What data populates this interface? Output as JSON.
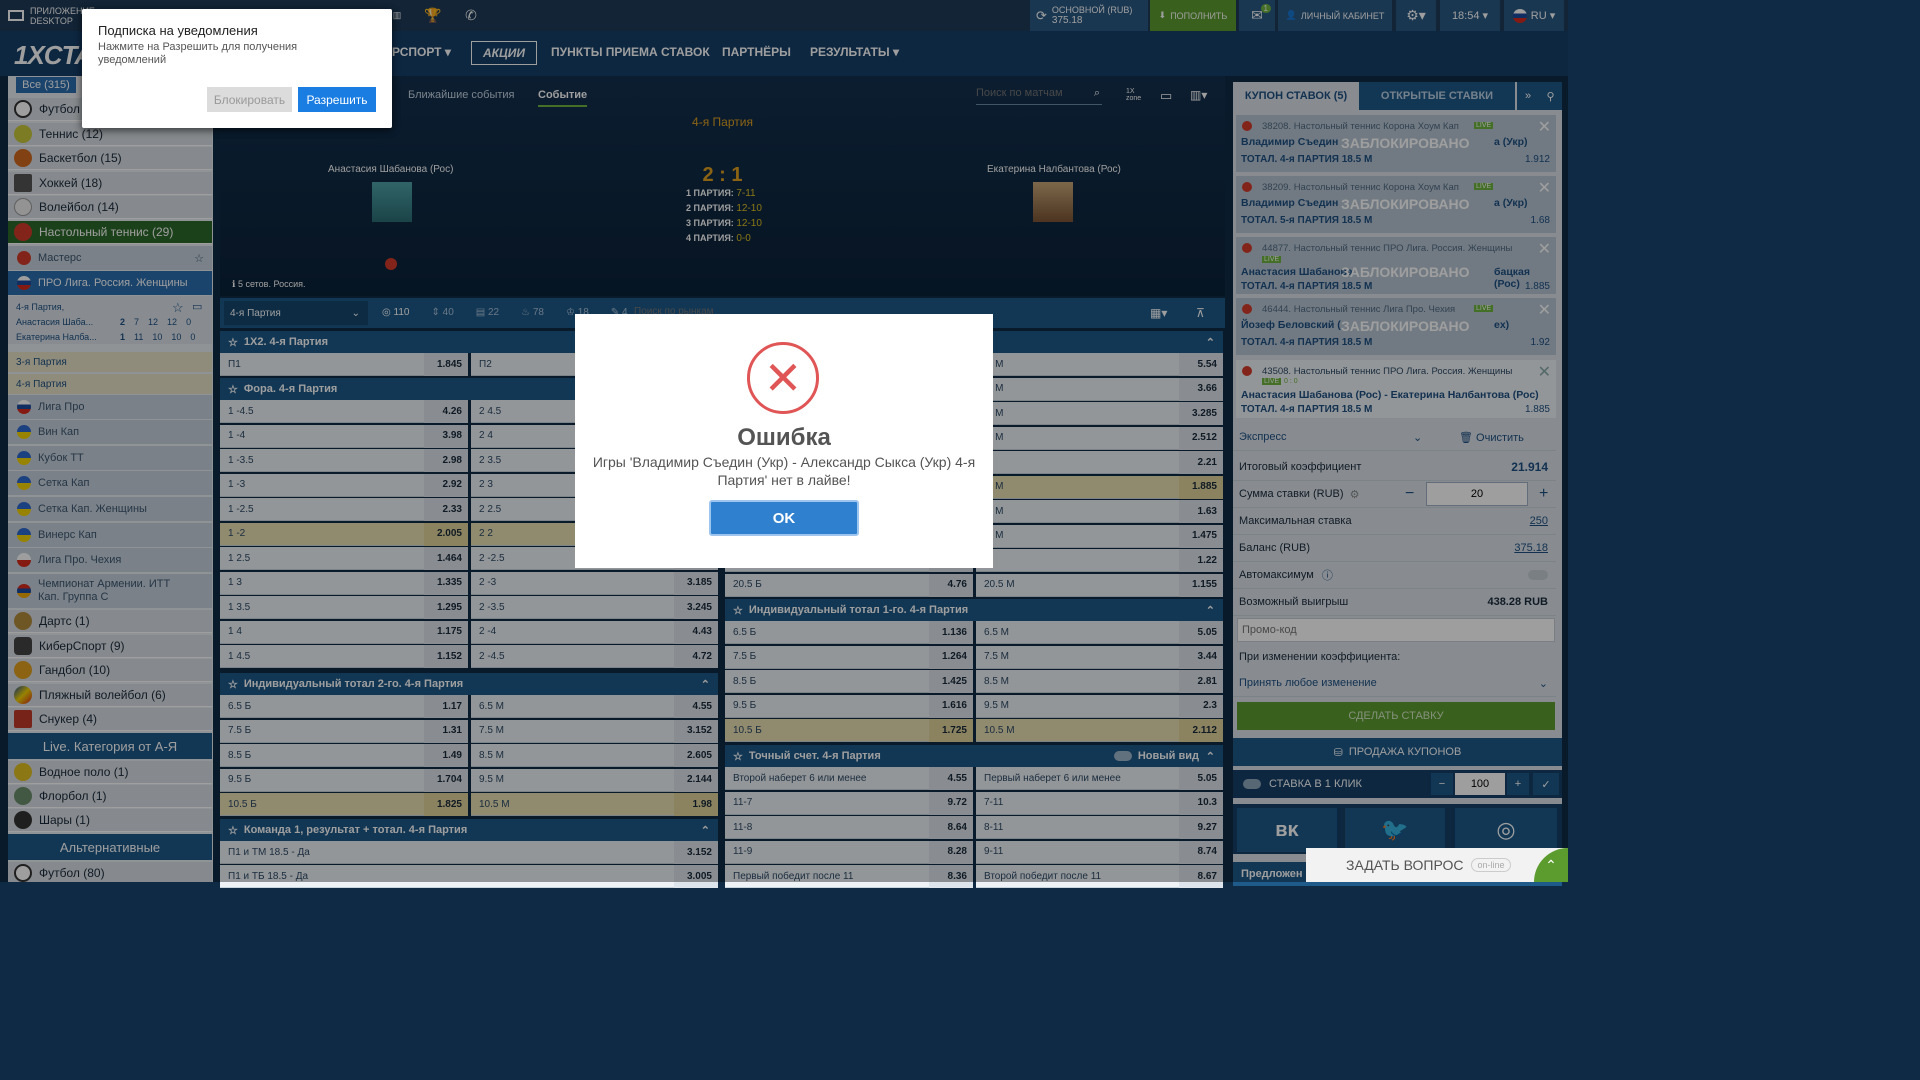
{
  "topbar": {
    "desktop_app": "ПРИЛОЖЕНИЕ DESKTOP",
    "balance_label": "ОСНОВНОЙ (RUB)",
    "balance_value": "375.18",
    "deposit": "ПОПОЛНИТЬ",
    "messages_count": "1",
    "cabinet": "ЛИЧНЫЙ КАБИНЕТ",
    "time": "18:54",
    "lang": "RU"
  },
  "nav": {
    "logo": "1XCTA",
    "items": [
      "РСПОРТ",
      "АКЦИИ",
      "ПУНКТЫ ПРИЕМА СТАВОК",
      "ПАРТНЁРЫ",
      "РЕЗУЛЬТАТЫ"
    ]
  },
  "notification": {
    "title": "Подписка на уведомления",
    "text": "Нажмите на Разрешить для получения уведомлений",
    "block": "Блокировать",
    "allow": "Разрешить"
  },
  "sidebar": {
    "all": "Все (315)",
    "sports": [
      {
        "label": "Футбол",
        "color": "#ffffff"
      },
      {
        "label": "Теннис (12)",
        "color": "#c8c83a"
      },
      {
        "label": "Баскетбол (15)",
        "color": "#d2691e"
      },
      {
        "label": "Хоккей (18)",
        "color": "#555555"
      },
      {
        "label": "Волейбол (14)",
        "color": "#eeeeee"
      }
    ],
    "active_sport": "Настольный теннис (29)",
    "leagues_top": [
      "Мастерс",
      "ПРО Лига. Россия. Женщины"
    ],
    "live_match": {
      "period": "4-я Партия,",
      "p1": "Анастасия Шаба...",
      "p2": "Екатерина Налба...",
      "p1_scores": [
        "2",
        "7",
        "12",
        "12",
        "0"
      ],
      "p2_scores": [
        "1",
        "11",
        "10",
        "10",
        "0"
      ]
    },
    "periods": [
      "3-я Партия",
      "4-я Партия"
    ],
    "leagues": [
      "Лига Про",
      "Вин Кап",
      "Кубок ТТ",
      "Сетка Кап",
      "Сетка Кап. Женщины",
      "Винерс Кап",
      "Лига Про. Чехия",
      "Чемпионат Армении. ИТТ Кап. Группа С"
    ],
    "more_sports": [
      "Дартс (1)",
      "КиберСпорт (9)",
      "Гандбол (10)",
      "Пляжный волейбол (6)",
      "Снукер (4)"
    ],
    "live_category": "Live. Категория от А-Я",
    "live_sports": [
      "Водное поло (1)",
      "Флорбол (1)",
      "Шары (1)"
    ],
    "alternative": "Альтернативные",
    "alt_sports": [
      "Футбол (80)"
    ]
  },
  "event": {
    "tabs": [
      "Ближайшие события",
      "Событие"
    ],
    "search_placeholder": "Поиск по матчам",
    "period": "4-я Партия",
    "player1": "Анастасия Шабанова (Рос)",
    "player2": "Екатерина Налбантова (Рос)",
    "score": "2 : 1",
    "sets": [
      {
        "label": "1 ПАРТИЯ:",
        "score": "7-11"
      },
      {
        "label": "2 ПАРТИЯ:",
        "score": "12-10"
      },
      {
        "label": "3 ПАРТИЯ:",
        "score": "12-10"
      },
      {
        "label": "4 ПАРТИЯ:",
        "score": "0-0"
      }
    ],
    "info": "5 сетов. Россия.",
    "market_select": "4-я Партия",
    "counts": [
      "110",
      "40",
      "22",
      "78",
      "18",
      "4"
    ],
    "market_search": "Поиск по рынкам"
  },
  "markets": {
    "m1x2": {
      "title": "1X2. 4-я Партия",
      "rows": [
        [
          "П1",
          "1.845",
          "П2",
          ""
        ]
      ]
    },
    "fora": {
      "title": "Фора. 4-я Партия",
      "rows": [
        [
          "1 -4.5",
          "4.26",
          "2 4.5",
          ""
        ],
        [
          "1 -4",
          "3.98",
          "2 4",
          ""
        ],
        [
          "1 -3.5",
          "2.98",
          "2 3.5",
          ""
        ],
        [
          "1 -3",
          "2.92",
          "2 3",
          ""
        ],
        [
          "1 -2.5",
          "2.33",
          "2 2.5",
          ""
        ],
        [
          "1 -2",
          "2.005",
          "2 2",
          ""
        ],
        [
          "1 2.5",
          "1.464",
          "2 -2.5",
          ""
        ],
        [
          "1 3",
          "1.335",
          "2 -3",
          "3.185"
        ],
        [
          "1 3.5",
          "1.295",
          "2 -3.5",
          "3.245"
        ],
        [
          "1 4",
          "1.175",
          "2 -4",
          "4.43"
        ],
        [
          "1 4.5",
          "1.152",
          "2 -4.5",
          "4.72"
        ]
      ]
    },
    "total_right": [
      [
        "",
        "",
        ".5 М",
        "5.54"
      ],
      [
        "",
        "",
        ".5 М",
        "3.66"
      ],
      [
        "",
        "",
        ".7 М",
        "3.285"
      ],
      [
        "",
        "",
        ".5 М",
        "2.512"
      ],
      [
        "",
        "",
        "М",
        "2.21"
      ],
      [
        "",
        "",
        ".5 М",
        "1.885"
      ],
      [
        "",
        "",
        ".9 М",
        "1.63"
      ],
      [
        "",
        "",
        ".5 М",
        "1.475"
      ],
      [
        "",
        "",
        "М",
        "1.22"
      ],
      [
        "20.5 Б",
        "4.76",
        "20.5 М",
        "1.155"
      ]
    ],
    "ind1": {
      "title": "Индивидуальный тотал 1-го. 4-я Партия",
      "rows": [
        [
          "6.5 Б",
          "1.136",
          "6.5 М",
          "5.05"
        ],
        [
          "7.5 Б",
          "1.264",
          "7.5 М",
          "3.44"
        ],
        [
          "8.5 Б",
          "1.425",
          "8.5 М",
          "2.81"
        ],
        [
          "9.5 Б",
          "1.616",
          "9.5 М",
          "2.3"
        ],
        [
          "10.5 Б",
          "1.725",
          "10.5 М",
          "2.112"
        ]
      ]
    },
    "ind2": {
      "title": "Индивидуальный тотал 2-го. 4-я Партия",
      "rows": [
        [
          "6.5 Б",
          "1.17",
          "6.5 М",
          "4.55"
        ],
        [
          "7.5 Б",
          "1.31",
          "7.5 М",
          "3.152"
        ],
        [
          "8.5 Б",
          "1.49",
          "8.5 М",
          "2.605"
        ],
        [
          "9.5 Б",
          "1.704",
          "9.5 М",
          "2.144"
        ],
        [
          "10.5 Б",
          "1.825",
          "10.5 М",
          "1.98"
        ]
      ]
    },
    "exact": {
      "title": "Точный счет. 4-я Партия",
      "new_view": "Новый вид",
      "rows": [
        [
          "Второй наберет 6 или менее",
          "4.55",
          "Первый наберет 6 или менее",
          "5.05"
        ],
        [
          "11-7",
          "9.72",
          "7-11",
          "10.3"
        ],
        [
          "11-8",
          "8.64",
          "8-11",
          "9.27"
        ],
        [
          "11-9",
          "8.28",
          "9-11",
          "8.74"
        ],
        [
          "Первый победит после 11",
          "8.36",
          "Второй победит после 11",
          "8.67"
        ]
      ]
    },
    "team1": {
      "title": "Команда 1, результат + тотал. 4-я Партия",
      "rows": [
        [
          "П1 и ТМ 18.5 - Да",
          "3.152"
        ],
        [
          "П1 и ТБ 18.5 - Да",
          "3.005"
        ]
      ]
    }
  },
  "coupon": {
    "tab_coupon": "КУПОН СТАВОК (5)",
    "tab_open": "ОТКРЫТЫЕ СТАВКИ",
    "blocked": "ЗАБЛОКИРОВАНО",
    "live": "LIVE",
    "bets": [
      {
        "id": "38208. Настольный теннис Корона Хоум Кап",
        "teams": "Владимир Съедин",
        "teams_tail": "а (Укр)",
        "market": "ТОТАЛ. 4-я ПАРТИЯ 18.5 М",
        "odd": "1.912"
      },
      {
        "id": "38209. Настольный теннис Корона Хоум Кап",
        "teams": "Владимир Съедин",
        "teams_tail": "а (Укр)",
        "market": "ТОТАЛ. 5-я ПАРТИЯ 18.5 М",
        "odd": "1.68"
      },
      {
        "id": "44877. Настольный теннис ПРО Лига. Россия. Женщины",
        "teams": "Анастасия Шабанова",
        "teams_tail": "бацкая (Рос)",
        "market": "ТОТАЛ. 4-я ПАРТИЯ 18.5 М",
        "odd": "1.885"
      },
      {
        "id": "46444. Настольный теннис Лига Про. Чехия",
        "teams": "Йозеф Беловский (",
        "teams_tail": "ex)",
        "market": "ТОТАЛ. 4-я ПАРТИЯ 18.5 М",
        "odd": "1.92"
      }
    ],
    "active_bet": {
      "id": "43508. Настольный теннис ПРО Лига. Россия. Женщины",
      "live_score": "0 : 0",
      "teams": "Анастасия Шабанова (Рос) - Екатерина Налбантова (Рос)",
      "market": "ТОТАЛ. 4-я ПАРТИЯ 18.5 М",
      "odd": "1.885"
    },
    "express": "Экспресс",
    "clear": "Очистить",
    "total_coef_label": "Итоговый коэффициент",
    "total_coef": "21.914",
    "stake_label": "Сумма ставки (RUB)",
    "stake": "20",
    "max_stake_label": "Максимальная ставка",
    "max_stake": "250",
    "balance_label": "Баланс (RUB)",
    "balance": "375.18",
    "automax": "Автомаксимум",
    "possible_win_label": "Возможный выигрыш",
    "possible_win": "438.28 RUB",
    "promo_placeholder": "Промо-код",
    "on_change_label": "При изменении коэффициента:",
    "on_change_value": "Принять любое изменение",
    "place_bet": "СДЕЛАТЬ СТАВКУ",
    "sell": "ПРОДАЖА КУПОНОВ",
    "one_click": "СТАВКА В 1 КЛИК",
    "one_click_value": "100",
    "offers": "Предложен"
  },
  "modal": {
    "title": "Ошибка",
    "message": "Игры 'Владимир Съедин (Укр) - Александр Сыкса (Укр) 4-я Партия' нет в лайве!",
    "ok": "OK"
  },
  "help": {
    "label": "ЗАДАТЬ ВОПРОС",
    "status": "on-line"
  }
}
